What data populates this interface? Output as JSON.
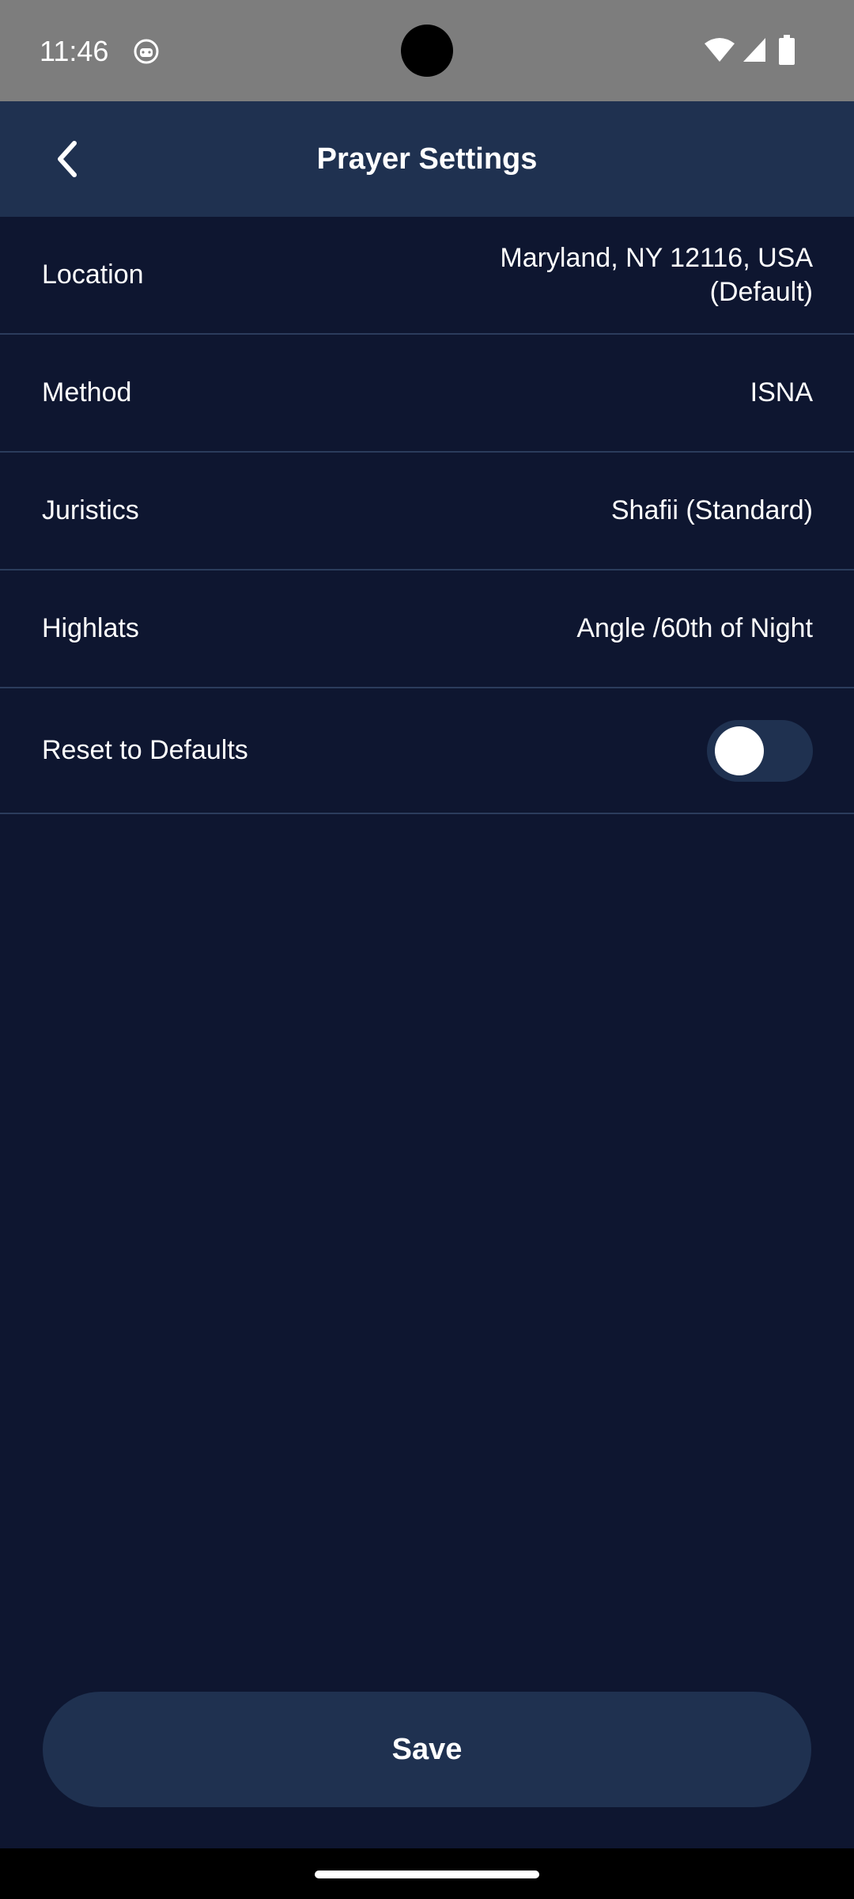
{
  "status_bar": {
    "time": "11:46",
    "app_icon": "android-debug-icon",
    "wifi_icon": "wifi-icon",
    "signal_icon": "cell-signal-icon",
    "battery_icon": "battery-icon"
  },
  "header": {
    "title": "Prayer Settings",
    "back_icon": "chevron-left-icon"
  },
  "settings": {
    "location": {
      "label": "Location",
      "value_line1": "Maryland, NY 12116, USA",
      "value_line2": "(Default)"
    },
    "method": {
      "label": "Method",
      "value": "ISNA"
    },
    "juristics": {
      "label": "Juristics",
      "value": "Shafii (Standard)"
    },
    "highlats": {
      "label": "Highlats",
      "value": "Angle /60th of Night"
    },
    "reset": {
      "label": "Reset to Defaults",
      "enabled": false
    }
  },
  "actions": {
    "save_label": "Save"
  },
  "colors": {
    "background": "#0e1630",
    "app_bar": "#1f3150",
    "divider": "#2b3c5c",
    "status_bar": "#7d7d7d",
    "text": "#ffffff"
  }
}
